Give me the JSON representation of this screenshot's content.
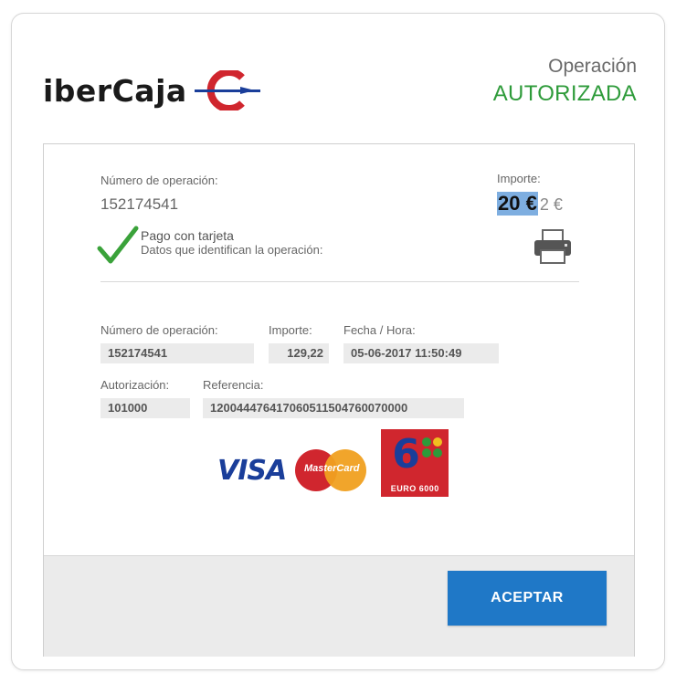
{
  "brand": {
    "name": "iberCaja"
  },
  "status": {
    "line1": "Operación",
    "line2": "AUTORIZADA"
  },
  "summary": {
    "operation_label": "Número de operación:",
    "operation_value": "152174541",
    "amount_label": "Importe:",
    "amount_value": "20 €",
    "amount_ghost": "2 €",
    "payment_title": "Pago con tarjeta",
    "payment_subtitle": "Datos que identifican la operación:"
  },
  "details": {
    "operation_label": "Número de operación:",
    "operation_value": "152174541",
    "amount_label": "Importe:",
    "amount_value": "129,22",
    "datetime_label": "Fecha / Hora:",
    "datetime_value": "05-06-2017 11:50:49",
    "auth_label": "Autorización:",
    "auth_value": "101000",
    "reference_label": "Referencia:",
    "reference_value": "120044476417060511504760070000"
  },
  "card_logos": {
    "visa": "VISA",
    "mastercard": "MasterCard",
    "euro6000": "EURO 6000",
    "euro6000_digit": "6"
  },
  "footer": {
    "accept_label": "ACEPTAR"
  },
  "colors": {
    "authorized": "#2e9b3a",
    "button": "#1f78c7",
    "brand_red": "#d0262e",
    "brand_blue": "#1a3e9a"
  }
}
